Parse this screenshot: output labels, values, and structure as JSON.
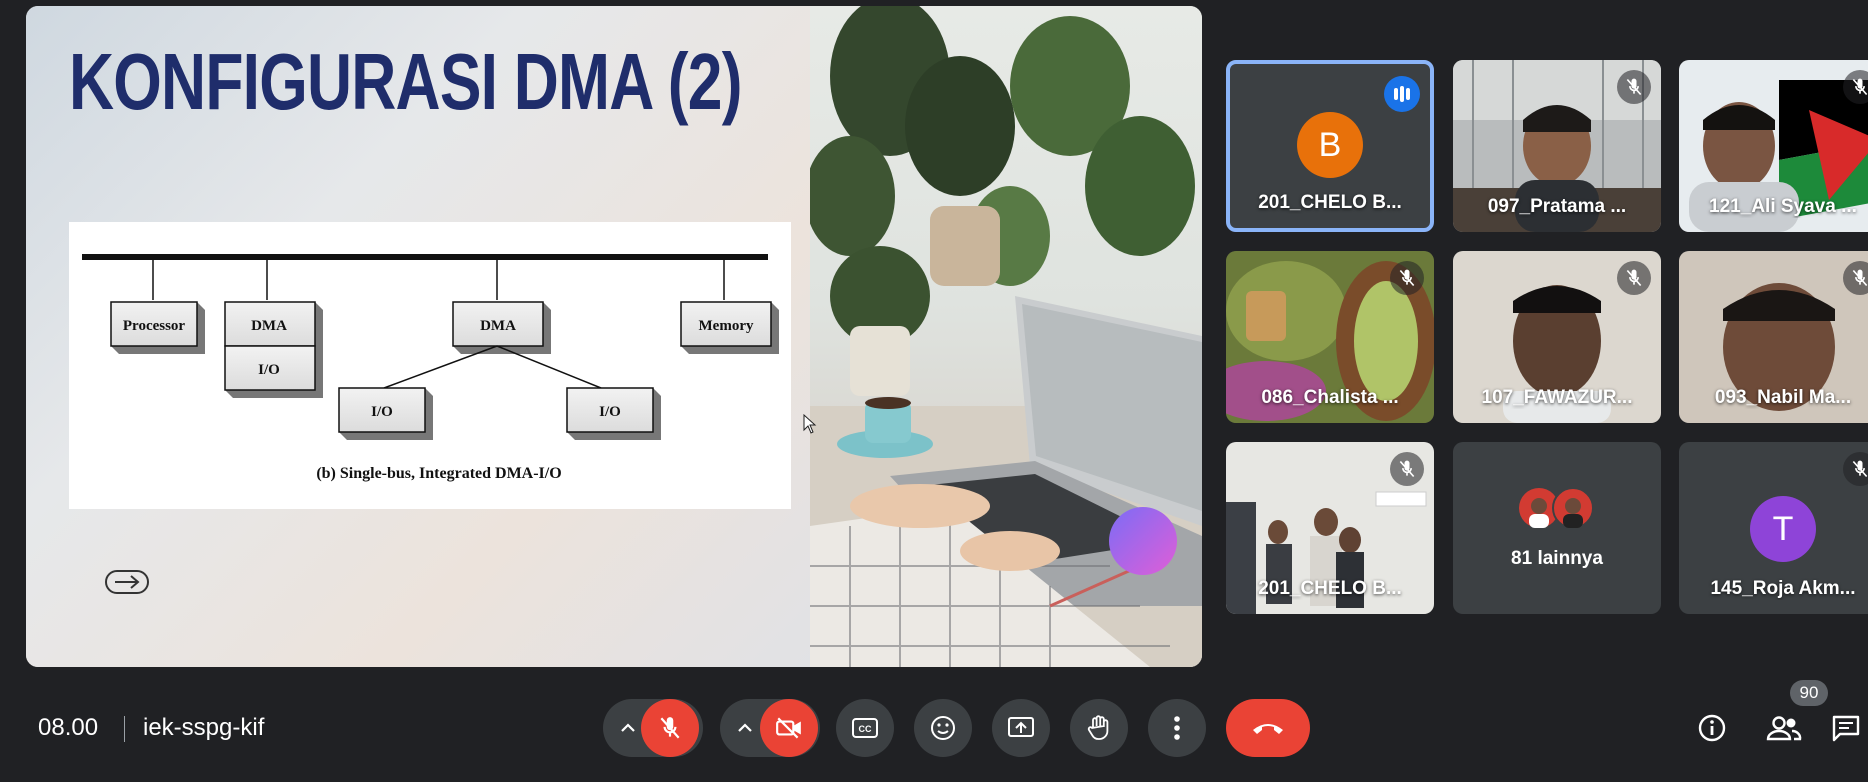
{
  "meeting": {
    "time": "08.00",
    "code": "iek-sspg-kif",
    "participant_count": "90"
  },
  "slide": {
    "title": "KONFIGURASI DMA (2)",
    "diagram": {
      "processor": "Processor",
      "dma1": "DMA",
      "io_attached": "I/O",
      "dma2": "DMA",
      "memory": "Memory",
      "io_left": "I/O",
      "io_right": "I/O",
      "caption_prefix": "(b) ",
      "caption": "Single-bus, Integrated DMA-I/O"
    }
  },
  "participants": [
    {
      "name": "201_CHELO B...",
      "avatar_letter": "B",
      "avatar_color": "#e8710a",
      "speaking": true
    },
    {
      "name": "097_Pratama ...",
      "muted": true
    },
    {
      "name": "121_Ali Syava ...",
      "muted": true
    },
    {
      "name": "086_Chalista ...",
      "muted": true
    },
    {
      "name": "107_FAWAZUR...",
      "muted": true
    },
    {
      "name": "093_Nabil Ma...",
      "muted": true
    },
    {
      "name": "201_CHELO B...",
      "muted": true
    },
    {
      "name": "81 lainnya"
    },
    {
      "name": "145_Roja Akm...",
      "avatar_letter": "T",
      "avatar_color": "#8e44d8",
      "muted": true
    }
  ],
  "colors": {
    "background": "#202124",
    "control": "#3c4043",
    "danger": "#ea4335",
    "accent": "#8ab4f8",
    "title": "#1f2d6b"
  },
  "icons": {
    "mic": "mic-off-icon",
    "camera": "camera-off-icon",
    "captions": "closed-captions-icon",
    "reactions": "emoji-icon",
    "present": "present-screen-icon",
    "hand": "raise-hand-icon",
    "more": "more-vert-icon",
    "leave": "leave-call-icon",
    "info": "info-icon",
    "people": "people-icon",
    "chat": "chat-icon"
  }
}
